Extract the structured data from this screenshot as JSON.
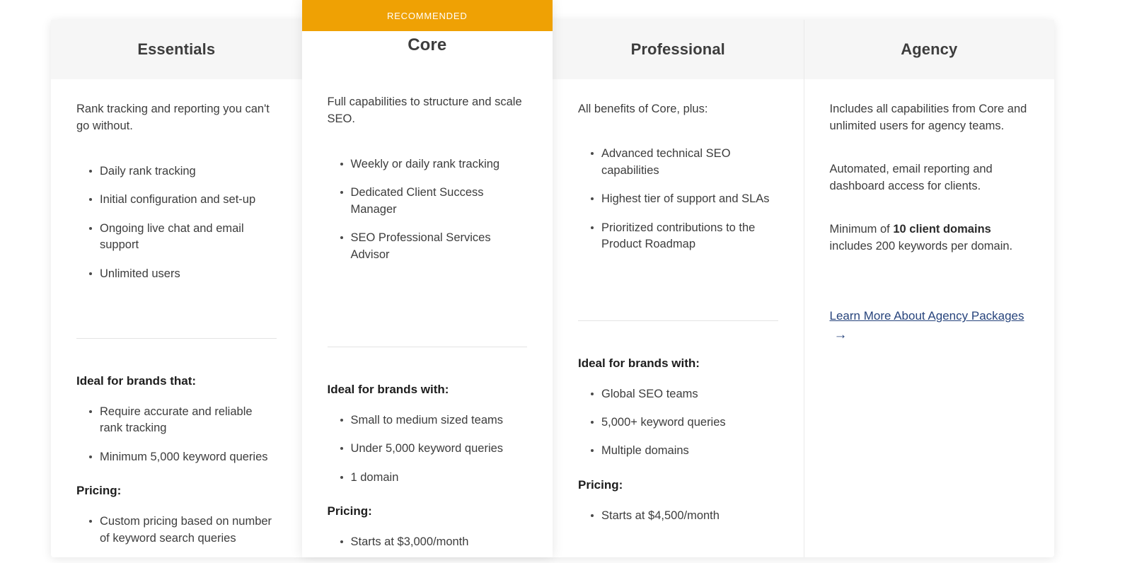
{
  "theme": {
    "accent": "#efa104",
    "header_bg": "#f6f6f6",
    "link_color": "#27447c",
    "text_color": "#3d3d3d"
  },
  "ribbon": {
    "label": "RECOMMENDED"
  },
  "columns": [
    {
      "name": "Essentials",
      "featured": false,
      "lede": "Rank tracking and reporting you can't go without.",
      "features": [
        "Daily rank tracking",
        "Initial configuration and set-up",
        "Ongoing live chat and email support",
        "Unlimited users"
      ],
      "ideal_heading": "Ideal for brands that:",
      "ideal_items": [
        "Require accurate and reliable rank tracking",
        "Minimum 5,000 keyword queries"
      ],
      "pricing_heading": "Pricing:",
      "pricing_items": [
        "Custom pricing based on number of keyword search queries"
      ]
    },
    {
      "name": "Core",
      "featured": true,
      "lede": "Full capabilities to structure and scale SEO.",
      "features": [
        "Weekly or daily rank tracking",
        "Dedicated Client Success Manager",
        "SEO Professional Services Advisor"
      ],
      "ideal_heading": "Ideal for brands with:",
      "ideal_items": [
        "Small to medium sized teams",
        "Under 5,000 keyword queries",
        "1 domain"
      ],
      "pricing_heading": "Pricing:",
      "pricing_items": [
        "Starts at $3,000/month"
      ]
    },
    {
      "name": "Professional",
      "featured": false,
      "lede": "All benefits of Core, plus:",
      "features": [
        "Advanced technical SEO capabilities",
        "Highest tier of support and SLAs",
        "Prioritized contributions to the Product Roadmap"
      ],
      "ideal_heading": "Ideal for brands with:",
      "ideal_items": [
        "Global SEO teams",
        "5,000+ keyword queries",
        "Multiple domains"
      ],
      "pricing_heading": "Pricing:",
      "pricing_items": [
        "Starts at $4,500/month"
      ]
    }
  ],
  "agency": {
    "name": "Agency",
    "paragraph_1": "Includes all capabilities from Core and unlimited users for agency teams.",
    "paragraph_2": "Automated, email reporting and dashboard access for clients.",
    "minimum_prefix": "Minimum of ",
    "minimum_bold": "10 client domains",
    "minimum_suffix": " includes 200 keywords per domain.",
    "link_label": "Learn More About Agency Packages",
    "link_arrow": "→"
  }
}
